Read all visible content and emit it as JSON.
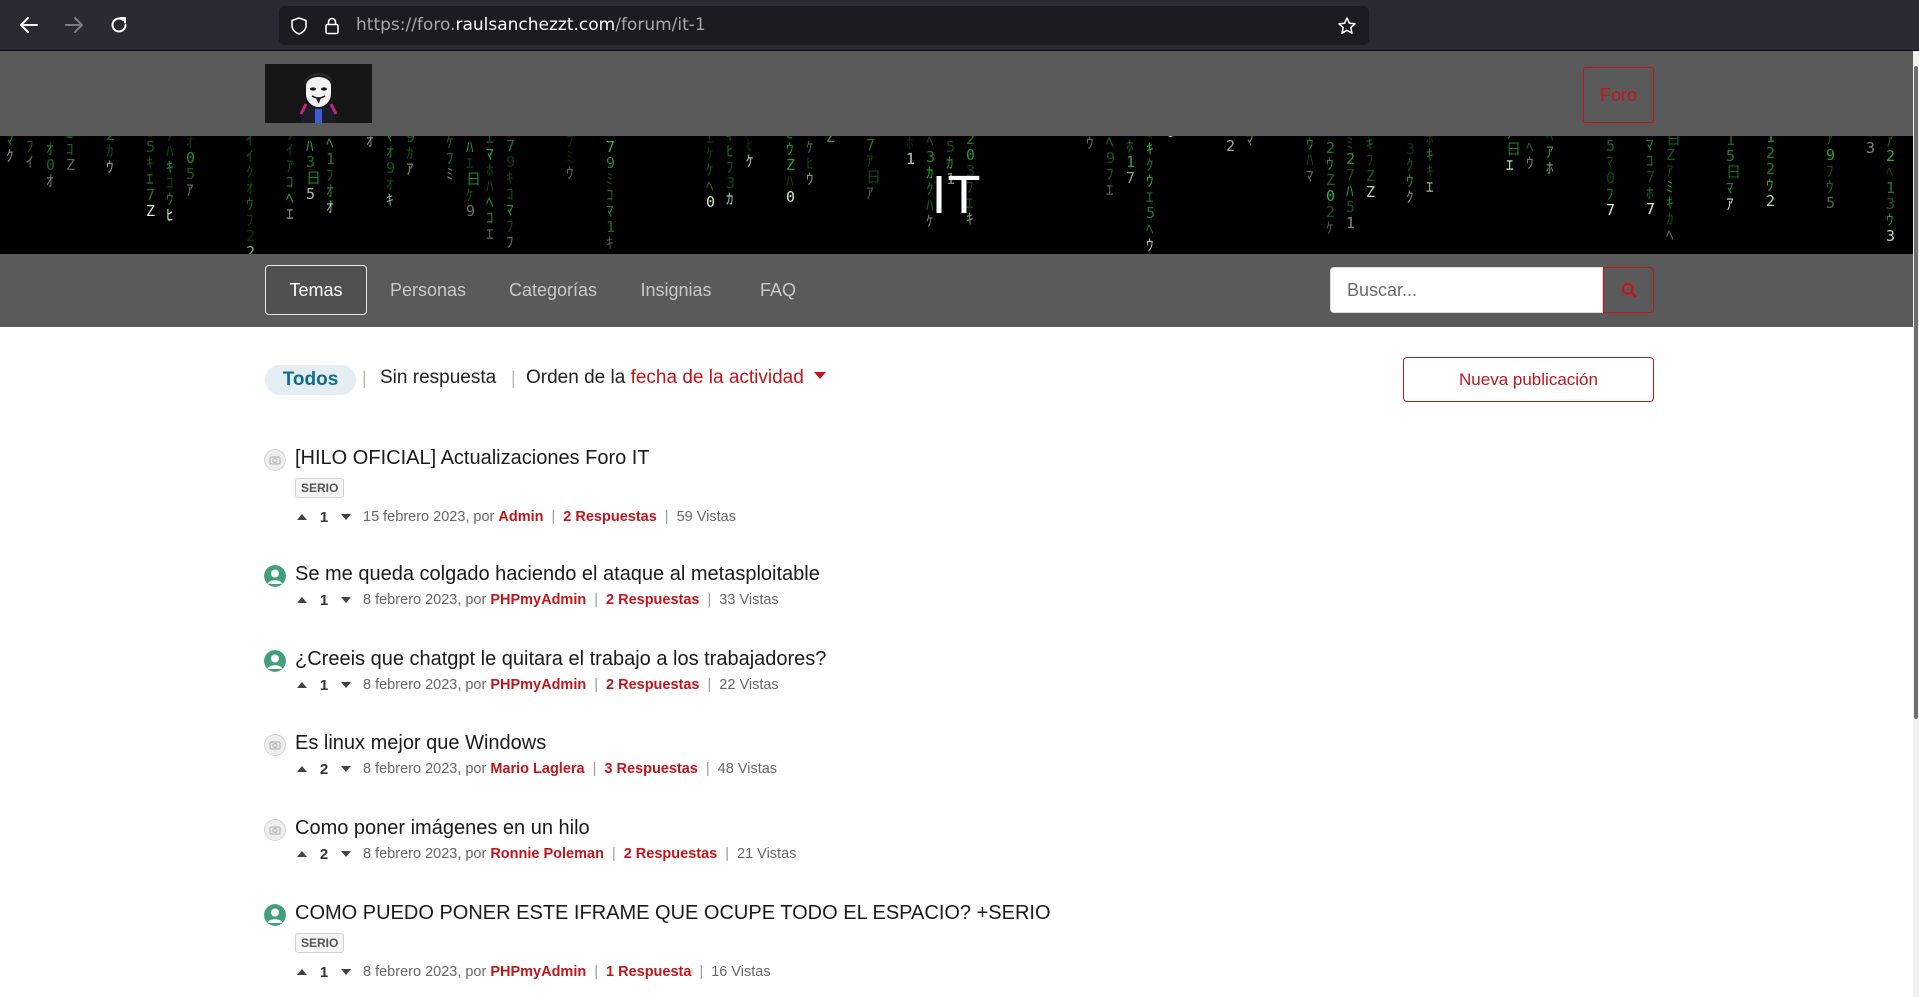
{
  "browser": {
    "url_prefix": "https://foro.",
    "url_domain": "raulsanchezzt.com",
    "url_path": "/forum/it-1"
  },
  "header": {
    "foro_label": "Foro"
  },
  "banner": {
    "title": "IT"
  },
  "tabs": [
    {
      "label": "Temas",
      "active": true
    },
    {
      "label": "Personas"
    },
    {
      "label": "Categorías"
    },
    {
      "label": "Insignias"
    },
    {
      "label": "FAQ"
    }
  ],
  "search": {
    "placeholder": "Buscar..."
  },
  "filters": {
    "all": "Todos",
    "unanswered": "Sin respuesta",
    "sort_prefix": "Orden de la",
    "sort_value": "fecha de la actividad",
    "separator": "|"
  },
  "new_post_label": "Nueva publicación",
  "meta_labels": {
    "by": "por"
  },
  "posts": [
    {
      "title": "[HILO OFICIAL] Actualizaciones Foro IT",
      "tag": "SERIO",
      "votes": "1",
      "date": "15 febrero 2023,",
      "author": "Admin",
      "replies": "2 Respuestas",
      "views": "59 Vistas",
      "avatar": "default"
    },
    {
      "title": "Se me queda colgado haciendo el ataque al metasploitable",
      "votes": "1",
      "date": "8 febrero 2023,",
      "author": "PHPmyAdmin",
      "replies": "2 Respuestas",
      "views": "33 Vistas",
      "avatar": "green"
    },
    {
      "title": "¿Creeis que chatgpt le quitara el trabajo a los trabajadores?",
      "votes": "1",
      "date": "8 febrero 2023,",
      "author": "PHPmyAdmin",
      "replies": "2 Respuestas",
      "views": "22 Vistas",
      "avatar": "green"
    },
    {
      "title": "Es linux mejor que Windows",
      "votes": "2",
      "date": "8 febrero 2023,",
      "author": "Mario Laglera",
      "replies": "3 Respuestas",
      "views": "48 Vistas",
      "avatar": "default"
    },
    {
      "title": "Como poner imágenes en un hilo",
      "votes": "2",
      "date": "8 febrero 2023,",
      "author": "Ronnie Poleman",
      "replies": "2 Respuestas",
      "views": "21 Vistas",
      "avatar": "default"
    },
    {
      "title": "COMO PUEDO PONER ESTE IFRAME QUE OCUPE TODO EL ESPACIO? +SERIO",
      "tag": "SERIO",
      "votes": "1",
      "date": "8 febrero 2023,",
      "author": "PHPmyAdmin",
      "replies": "1 Respuesta",
      "views": "16 Vistas",
      "avatar": "green"
    }
  ],
  "colors": {
    "accent": "#c0161b",
    "header_bg": "#5a5a5a",
    "chip_bg": "#e4eef2",
    "chip_text": "#0f6e8c"
  }
}
